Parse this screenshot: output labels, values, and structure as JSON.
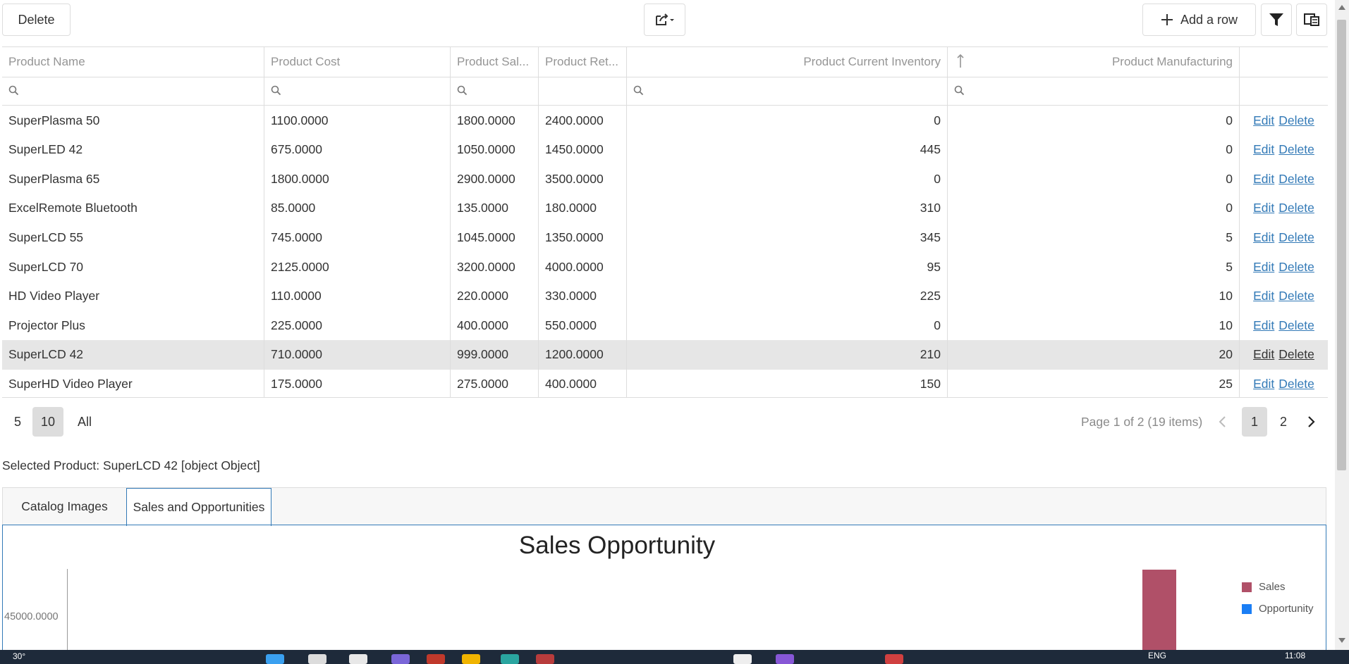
{
  "toolbar": {
    "delete_label": "Delete",
    "add_row_label": "Add a row"
  },
  "grid": {
    "columns": [
      "Product Name",
      "Product Cost",
      "Product Sal...",
      "Product Ret...",
      "Product Current Inventory",
      "Product Manufacturing"
    ],
    "rows": [
      {
        "name": "SuperPlasma 50",
        "cost": "1100.0000",
        "sale": "1800.0000",
        "retail": "2400.0000",
        "inventory": "0",
        "manufacturing": "0"
      },
      {
        "name": "SuperLED 42",
        "cost": "675.0000",
        "sale": "1050.0000",
        "retail": "1450.0000",
        "inventory": "445",
        "manufacturing": "0"
      },
      {
        "name": "SuperPlasma 65",
        "cost": "1800.0000",
        "sale": "2900.0000",
        "retail": "3500.0000",
        "inventory": "0",
        "manufacturing": "0"
      },
      {
        "name": "ExcelRemote Bluetooth",
        "cost": "85.0000",
        "sale": "135.0000",
        "retail": "180.0000",
        "inventory": "310",
        "manufacturing": "0"
      },
      {
        "name": "SuperLCD 55",
        "cost": "745.0000",
        "sale": "1045.0000",
        "retail": "1350.0000",
        "inventory": "345",
        "manufacturing": "5"
      },
      {
        "name": "SuperLCD 70",
        "cost": "2125.0000",
        "sale": "3200.0000",
        "retail": "4000.0000",
        "inventory": "95",
        "manufacturing": "5"
      },
      {
        "name": "HD Video Player",
        "cost": "110.0000",
        "sale": "220.0000",
        "retail": "330.0000",
        "inventory": "225",
        "manufacturing": "10"
      },
      {
        "name": "Projector Plus",
        "cost": "225.0000",
        "sale": "400.0000",
        "retail": "550.0000",
        "inventory": "0",
        "manufacturing": "10"
      },
      {
        "name": "SuperLCD 42",
        "cost": "710.0000",
        "sale": "999.0000",
        "retail": "1200.0000",
        "inventory": "210",
        "manufacturing": "20",
        "selected": true
      },
      {
        "name": "SuperHD Video Player",
        "cost": "175.0000",
        "sale": "275.0000",
        "retail": "400.0000",
        "inventory": "150",
        "manufacturing": "25"
      }
    ],
    "edit_label": "Edit",
    "delete_label": "Delete"
  },
  "pager": {
    "sizes": [
      "5",
      "10",
      "All"
    ],
    "selected_size": "10",
    "info": "Page 1 of 2 (19 items)",
    "pages": [
      "1",
      "2"
    ],
    "current_page": "1"
  },
  "selected_text": "Selected Product: SuperLCD 42 [object Object]",
  "tabs": [
    "Catalog Images",
    "Sales and Opportunities"
  ],
  "active_tab": "Sales and Opportunities",
  "chart_data": {
    "type": "bar",
    "title": "Sales Opportunity",
    "y_ticks": [
      "45000.0000"
    ],
    "series": [
      {
        "name": "Sales",
        "color": "#b05068"
      },
      {
        "name": "Opportunity",
        "color": "#1a7ef5"
      }
    ],
    "legend_position": "right"
  },
  "taskbar": {
    "temperature": "30°",
    "language": "ENG",
    "time": "11:08"
  },
  "colors": {
    "link": "#337ab7",
    "border": "#dddddd",
    "selected_row": "#e6e6e6",
    "sales": "#b05068",
    "opportunity": "#1a7ef5"
  }
}
